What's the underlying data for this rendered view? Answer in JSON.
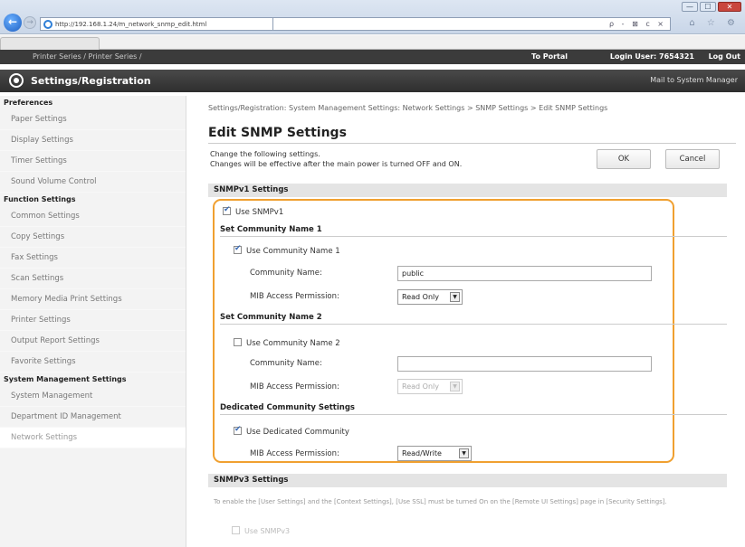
{
  "browser": {
    "url": "http://192.168.1.24/m_network_snmp_edit.html",
    "tools": "ρ - ⊠ c ×",
    "icons": "⌂ ☆ ⚙"
  },
  "window_controls": {
    "minimize": "—",
    "maximize": "☐",
    "close": "✕"
  },
  "topbar": {
    "device": "Printer Series / Printer Series /",
    "portal": "To Portal",
    "login": "Login User: 7654321",
    "logout": "Log Out"
  },
  "header": {
    "title": "Settings/Registration",
    "mail": "Mail to System Manager"
  },
  "sidebar": {
    "preferences_head": "Preferences",
    "preferences": [
      "Paper Settings",
      "Display Settings",
      "Timer Settings",
      "Sound Volume Control"
    ],
    "function_head": "Function Settings",
    "function": [
      "Common Settings",
      "Copy Settings",
      "Fax Settings",
      "Scan Settings",
      "Memory Media Print Settings",
      "Printer Settings",
      "Output Report Settings",
      "Favorite Settings"
    ],
    "system_head": "System Management Settings",
    "system": [
      "System Management",
      "Department ID Management",
      "Network Settings"
    ]
  },
  "main": {
    "breadcrumb": "Settings/Registration: System Management Settings: Network Settings > SNMP Settings > Edit SNMP Settings",
    "title": "Edit SNMP Settings",
    "desc1": "Change the following settings.",
    "desc2": "Changes will be effective after the main power is turned OFF and ON.",
    "ok": "OK",
    "cancel": "Cancel",
    "v1": {
      "heading": "SNMPv1 Settings",
      "use_snmpv1": "Use SNMPv1",
      "set1_head": "Set Community Name 1",
      "use_cn1": "Use Community Name 1",
      "community_label_1": "Community Name:",
      "community_value_1": "public",
      "mib_label_1": "MIB Access Permission:",
      "mib_value_1": "Read Only",
      "set2_head": "Set Community Name 2",
      "use_cn2": "Use Community Name 2",
      "community_label_2": "Community Name:",
      "community_value_2": "",
      "mib_label_2": "MIB Access Permission:",
      "mib_value_2": "Read Only",
      "dedicated_head": "Dedicated Community Settings",
      "use_dedicated": "Use Dedicated Community",
      "mib_label_3": "MIB Access Permission:",
      "mib_value_3": "Read/Write"
    },
    "v3": {
      "heading": "SNMPv3 Settings",
      "text": "To enable the [User Settings] and the [Context Settings], [Use SSL] must be turned On on the [Remote UI Settings] page in [Security Settings].",
      "use_snmpv3": "Use SNMPv3"
    }
  },
  "colors": {
    "highlight_frame": "#f0a030",
    "header_bg": "#3a3a3a",
    "checkbox_check": "#3a6bb5"
  }
}
